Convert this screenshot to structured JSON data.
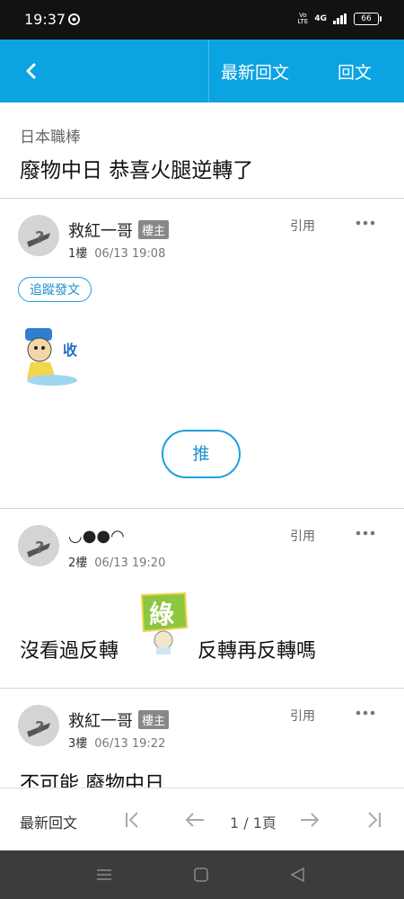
{
  "status_bar": {
    "time": "19:37",
    "network": "4G",
    "volte": "Vo LTE",
    "battery": "66"
  },
  "header": {
    "latest_label": "最新回文",
    "reply_label": "回文"
  },
  "thread": {
    "board": "日本職棒",
    "title": "廢物中日 恭喜火腿逆轉了"
  },
  "posts": [
    {
      "author": "救紅一哥",
      "badge": "樓主",
      "floor": "1樓",
      "time": "06/13 19:08",
      "quote": "引用",
      "follow": "追蹤發文",
      "push": "推"
    },
    {
      "author": "◡●●◠",
      "floor": "2樓",
      "time": "06/13 19:20",
      "quote": "引用",
      "text_before": "沒看過反轉",
      "sticker_text": "綠",
      "text_after": "反轉再反轉嗎"
    },
    {
      "author": "救紅一哥",
      "badge": "樓主",
      "floor": "3樓",
      "time": "06/13 19:22",
      "quote": "引用",
      "text": "不可能 廢物中日"
    }
  ],
  "pager": {
    "latest_label": "最新回文",
    "page": "1 / 1頁"
  },
  "icons": {
    "back": "chevron-left-icon",
    "more": "more-dots-icon",
    "first": "first-page-icon",
    "prev": "arrow-left-icon",
    "next": "arrow-right-icon",
    "last": "last-page-icon",
    "menu": "menu-icon",
    "home": "home-icon",
    "sys_back": "triangle-back-icon"
  },
  "colors": {
    "accent": "#0ba3e2",
    "link": "#1e8fd2",
    "badge": "#888888"
  }
}
